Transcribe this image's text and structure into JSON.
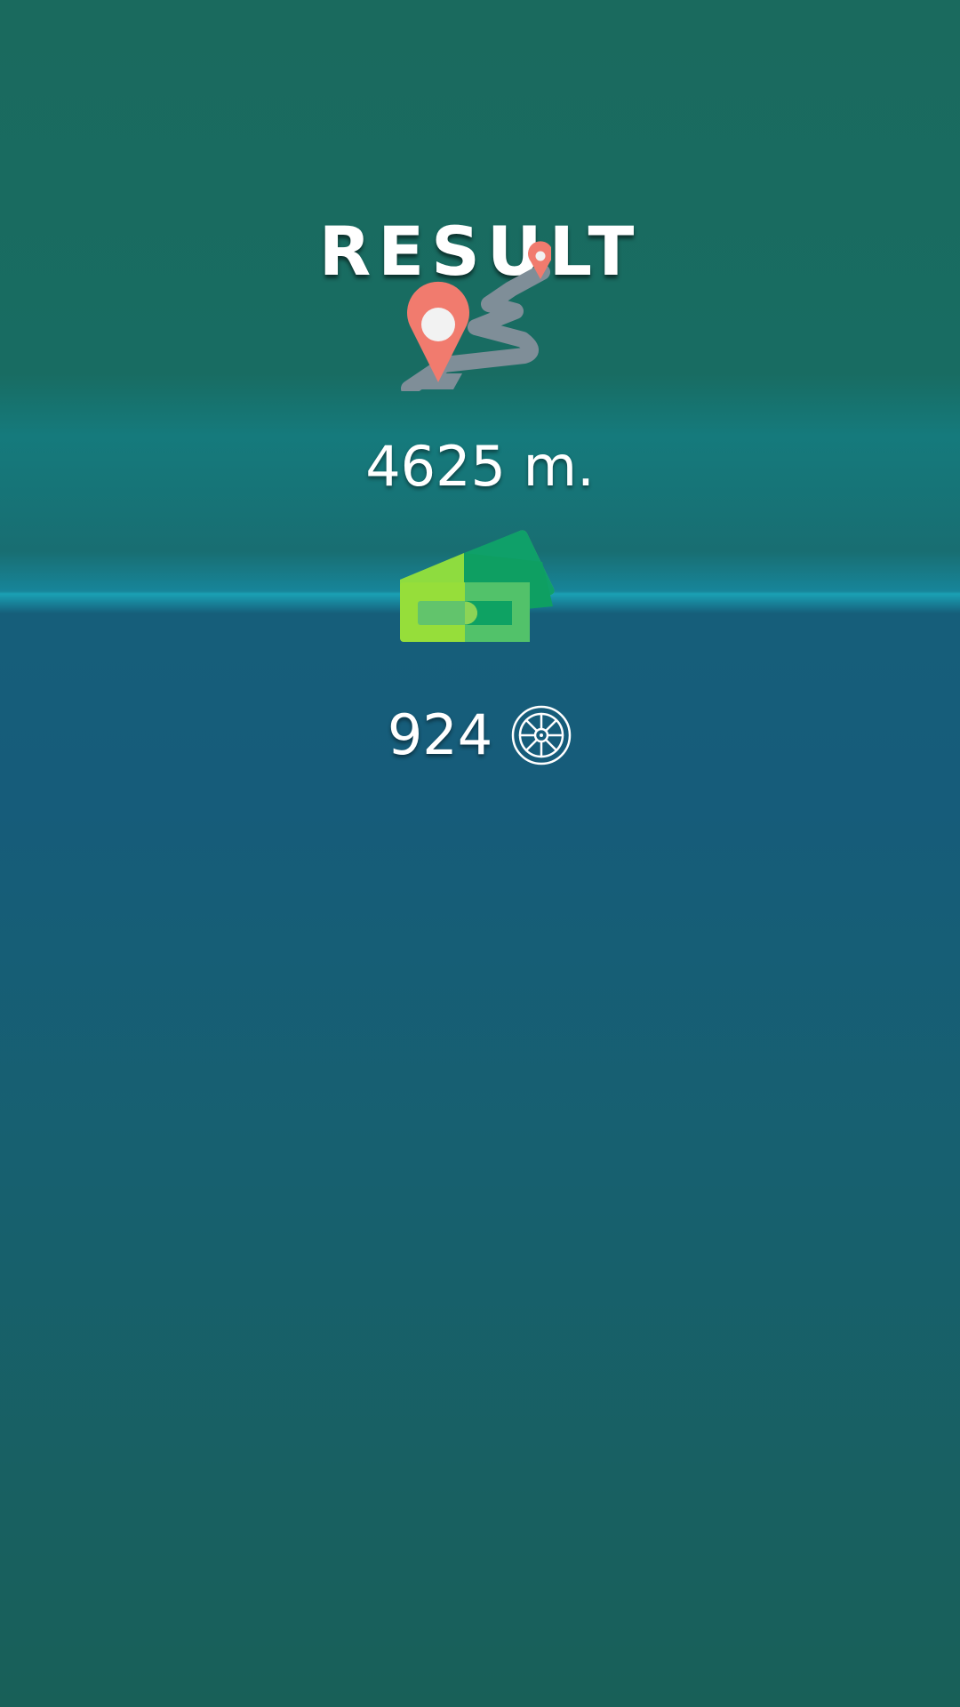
{
  "result_screen": {
    "title": "RESULT",
    "distance": "4625 m.",
    "coins": "924"
  },
  "icons": {
    "route": "route-map-pin-icon",
    "money": "cash-banknotes-icon",
    "coin": "wheel-coin-icon"
  },
  "colors": {
    "pin": "#f17b6e",
    "cash_light": "#8fdc45",
    "cash_dark": "#10a060",
    "text": "#ffffff"
  }
}
